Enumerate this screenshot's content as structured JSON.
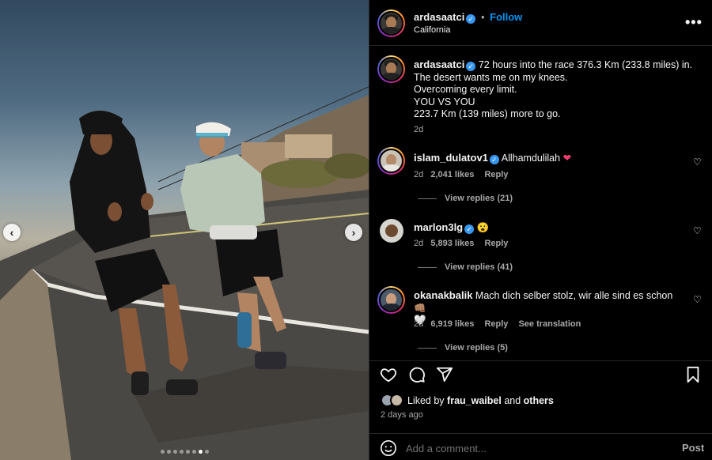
{
  "post": {
    "username": "ardasaatci",
    "follow_label": "Follow",
    "separator": "•",
    "location": "California",
    "more_label": "•••",
    "caption_lines": [
      "72 hours into the race 376.3 Km (233.8 miles) in.",
      "The desert wants me on my knees.",
      "Overcoming every limit.",
      "YOU VS YOU",
      "223.7 Km (139 miles) more to go."
    ],
    "caption_age": "2d"
  },
  "comments": [
    {
      "username": "islam_dulatov1",
      "text": "Allhamdulilah",
      "emoji": "❤",
      "age": "2d",
      "likes": "2,041 likes",
      "reply": "Reply",
      "view_replies": "View replies (21)"
    },
    {
      "username": "marlon3lg",
      "text": "",
      "emoji": "😮",
      "age": "2d",
      "likes": "5,893 likes",
      "reply": "Reply",
      "view_replies": "View replies (41)"
    },
    {
      "username": "okanakbalik",
      "text": "Mach dich selber stolz, wir alle sind es schon",
      "emoji": "👊🏽",
      "emoji2": "🤍",
      "age": "2d",
      "likes": "6,919 likes",
      "reply": "Reply",
      "translate": "See translation",
      "view_replies": "View replies (5)"
    }
  ],
  "likes": {
    "prefix": "Liked by",
    "user": "frau_waibel",
    "and": "and",
    "others": "others",
    "time": "2 days ago"
  },
  "comment_input": {
    "placeholder": "Add a comment...",
    "post_label": "Post"
  },
  "carousel": {
    "total": 8,
    "active": 7
  },
  "icons": {
    "prev": "chevron-left-icon",
    "next": "chevron-right-icon",
    "like": "heart-icon",
    "comment": "comment-icon",
    "share": "share-icon",
    "save": "bookmark-icon",
    "emoji": "emoji-icon"
  },
  "colors": {
    "accent": "#0095f6",
    "background": "#000000",
    "muted": "#a8a8a8",
    "verified": "#3897f0"
  }
}
